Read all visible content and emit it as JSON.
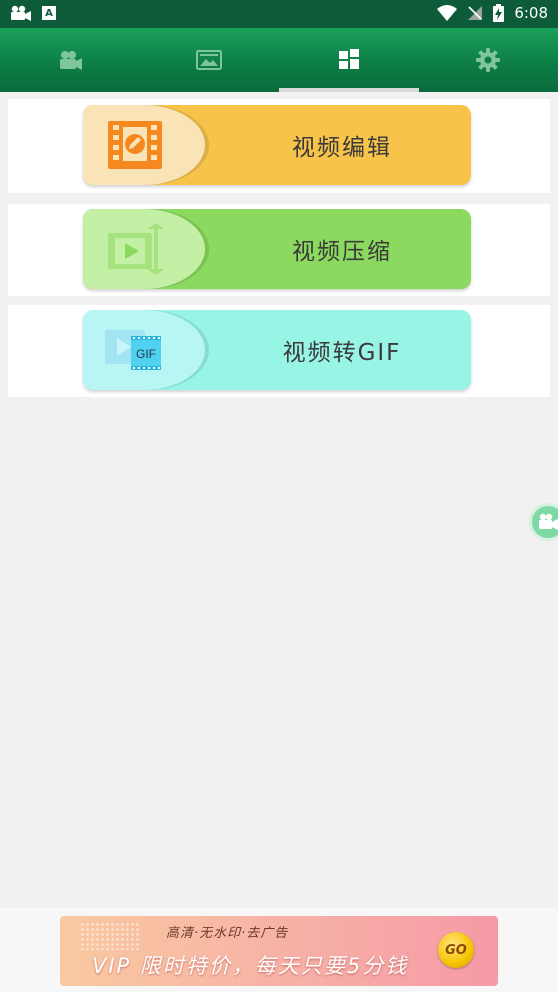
{
  "status_bar": {
    "time": "6:08",
    "notif_a": "A"
  },
  "tabs": [
    {
      "name": "video",
      "icon": "video-camera-icon",
      "selected": false
    },
    {
      "name": "photo",
      "icon": "image-icon",
      "selected": false
    },
    {
      "name": "tools",
      "icon": "grid-icon",
      "selected": true
    },
    {
      "name": "settings",
      "icon": "gear-icon",
      "selected": false
    }
  ],
  "features": [
    {
      "label": "视频编辑",
      "icon": "film-edit-icon",
      "cap_color": "#f9e3b7",
      "bar_color": "#f8c34b"
    },
    {
      "label": "视频压缩",
      "icon": "video-compress-icon",
      "cap_color": "#c3f0a4",
      "bar_color": "#8bd95f"
    },
    {
      "label": "视频转GIF",
      "icon": "gif-icon",
      "cap_color": "#b8f6f6",
      "bar_color": "#98f5e6",
      "icon_text": "GIF"
    }
  ],
  "ad": {
    "subtitle": "高清·无水印·去广告",
    "headline": "VIP 限时特价，每天只要5分钱",
    "go": "GO"
  }
}
